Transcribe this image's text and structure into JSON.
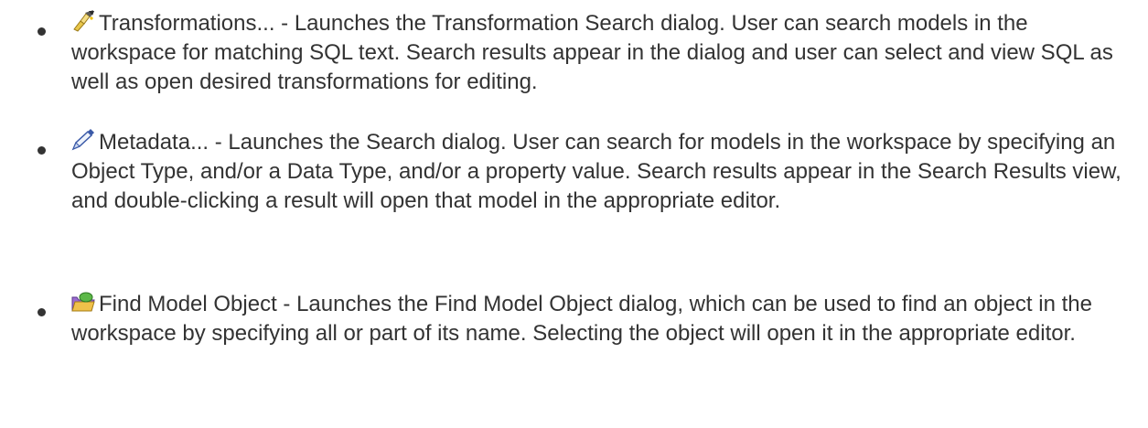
{
  "items": [
    {
      "icon": "transformation-search-icon",
      "text": "Transformations... - Launches the Transformation Search dialog. User can search models in the workspace for matching SQL text. Search results appear in the dialog and user can select and view SQL as well as open desired transformations for editing."
    },
    {
      "icon": "metadata-search-icon",
      "text": "Metadata... - Launches the Search dialog. User can search for models in the workspace by specifying an Object Type, and/or a Data Type, and/or a property value. Search results appear in the Search Results view, and double-clicking a result will open that model in the appropriate editor."
    },
    {
      "icon": "find-model-object-icon",
      "text": "Find Model Object - Launches the Find Model Object dialog, which can be used to find an object in the workspace by specifying all or part of its name. Selecting the object will open it in the appropriate editor."
    }
  ]
}
